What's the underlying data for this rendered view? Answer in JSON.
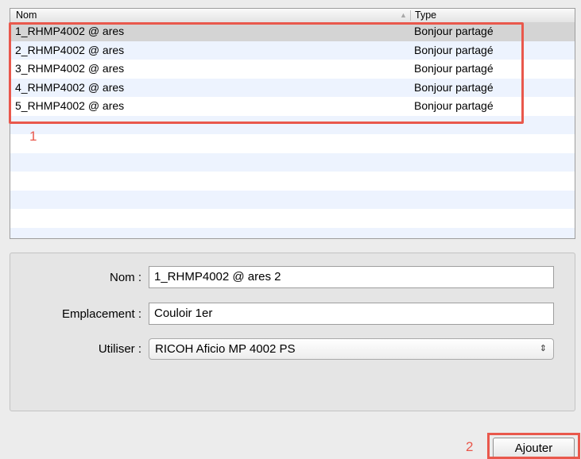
{
  "list": {
    "columns": {
      "name": "Nom",
      "type": "Type"
    },
    "rows": [
      {
        "name": "1_RHMP4002 @ ares",
        "type": "Bonjour partagé",
        "selected": true
      },
      {
        "name": "2_RHMP4002 @ ares",
        "type": "Bonjour partagé",
        "selected": false
      },
      {
        "name": "3_RHMP4002 @ ares",
        "type": "Bonjour partagé",
        "selected": false
      },
      {
        "name": "4_RHMP4002 @ ares",
        "type": "Bonjour partagé",
        "selected": false
      },
      {
        "name": "5_RHMP4002 @ ares",
        "type": "Bonjour partagé",
        "selected": false
      }
    ]
  },
  "annotations": {
    "label1": "1",
    "label2": "2",
    "color": "#e9584c"
  },
  "form": {
    "name_label": "Nom :",
    "name_value": "1_RHMP4002 @ ares 2",
    "location_label": "Emplacement :",
    "location_value": "Couloir 1er",
    "use_label": "Utiliser :",
    "use_value": "RICOH Aficio MP 4002 PS"
  },
  "actions": {
    "add_label": "Ajouter"
  }
}
